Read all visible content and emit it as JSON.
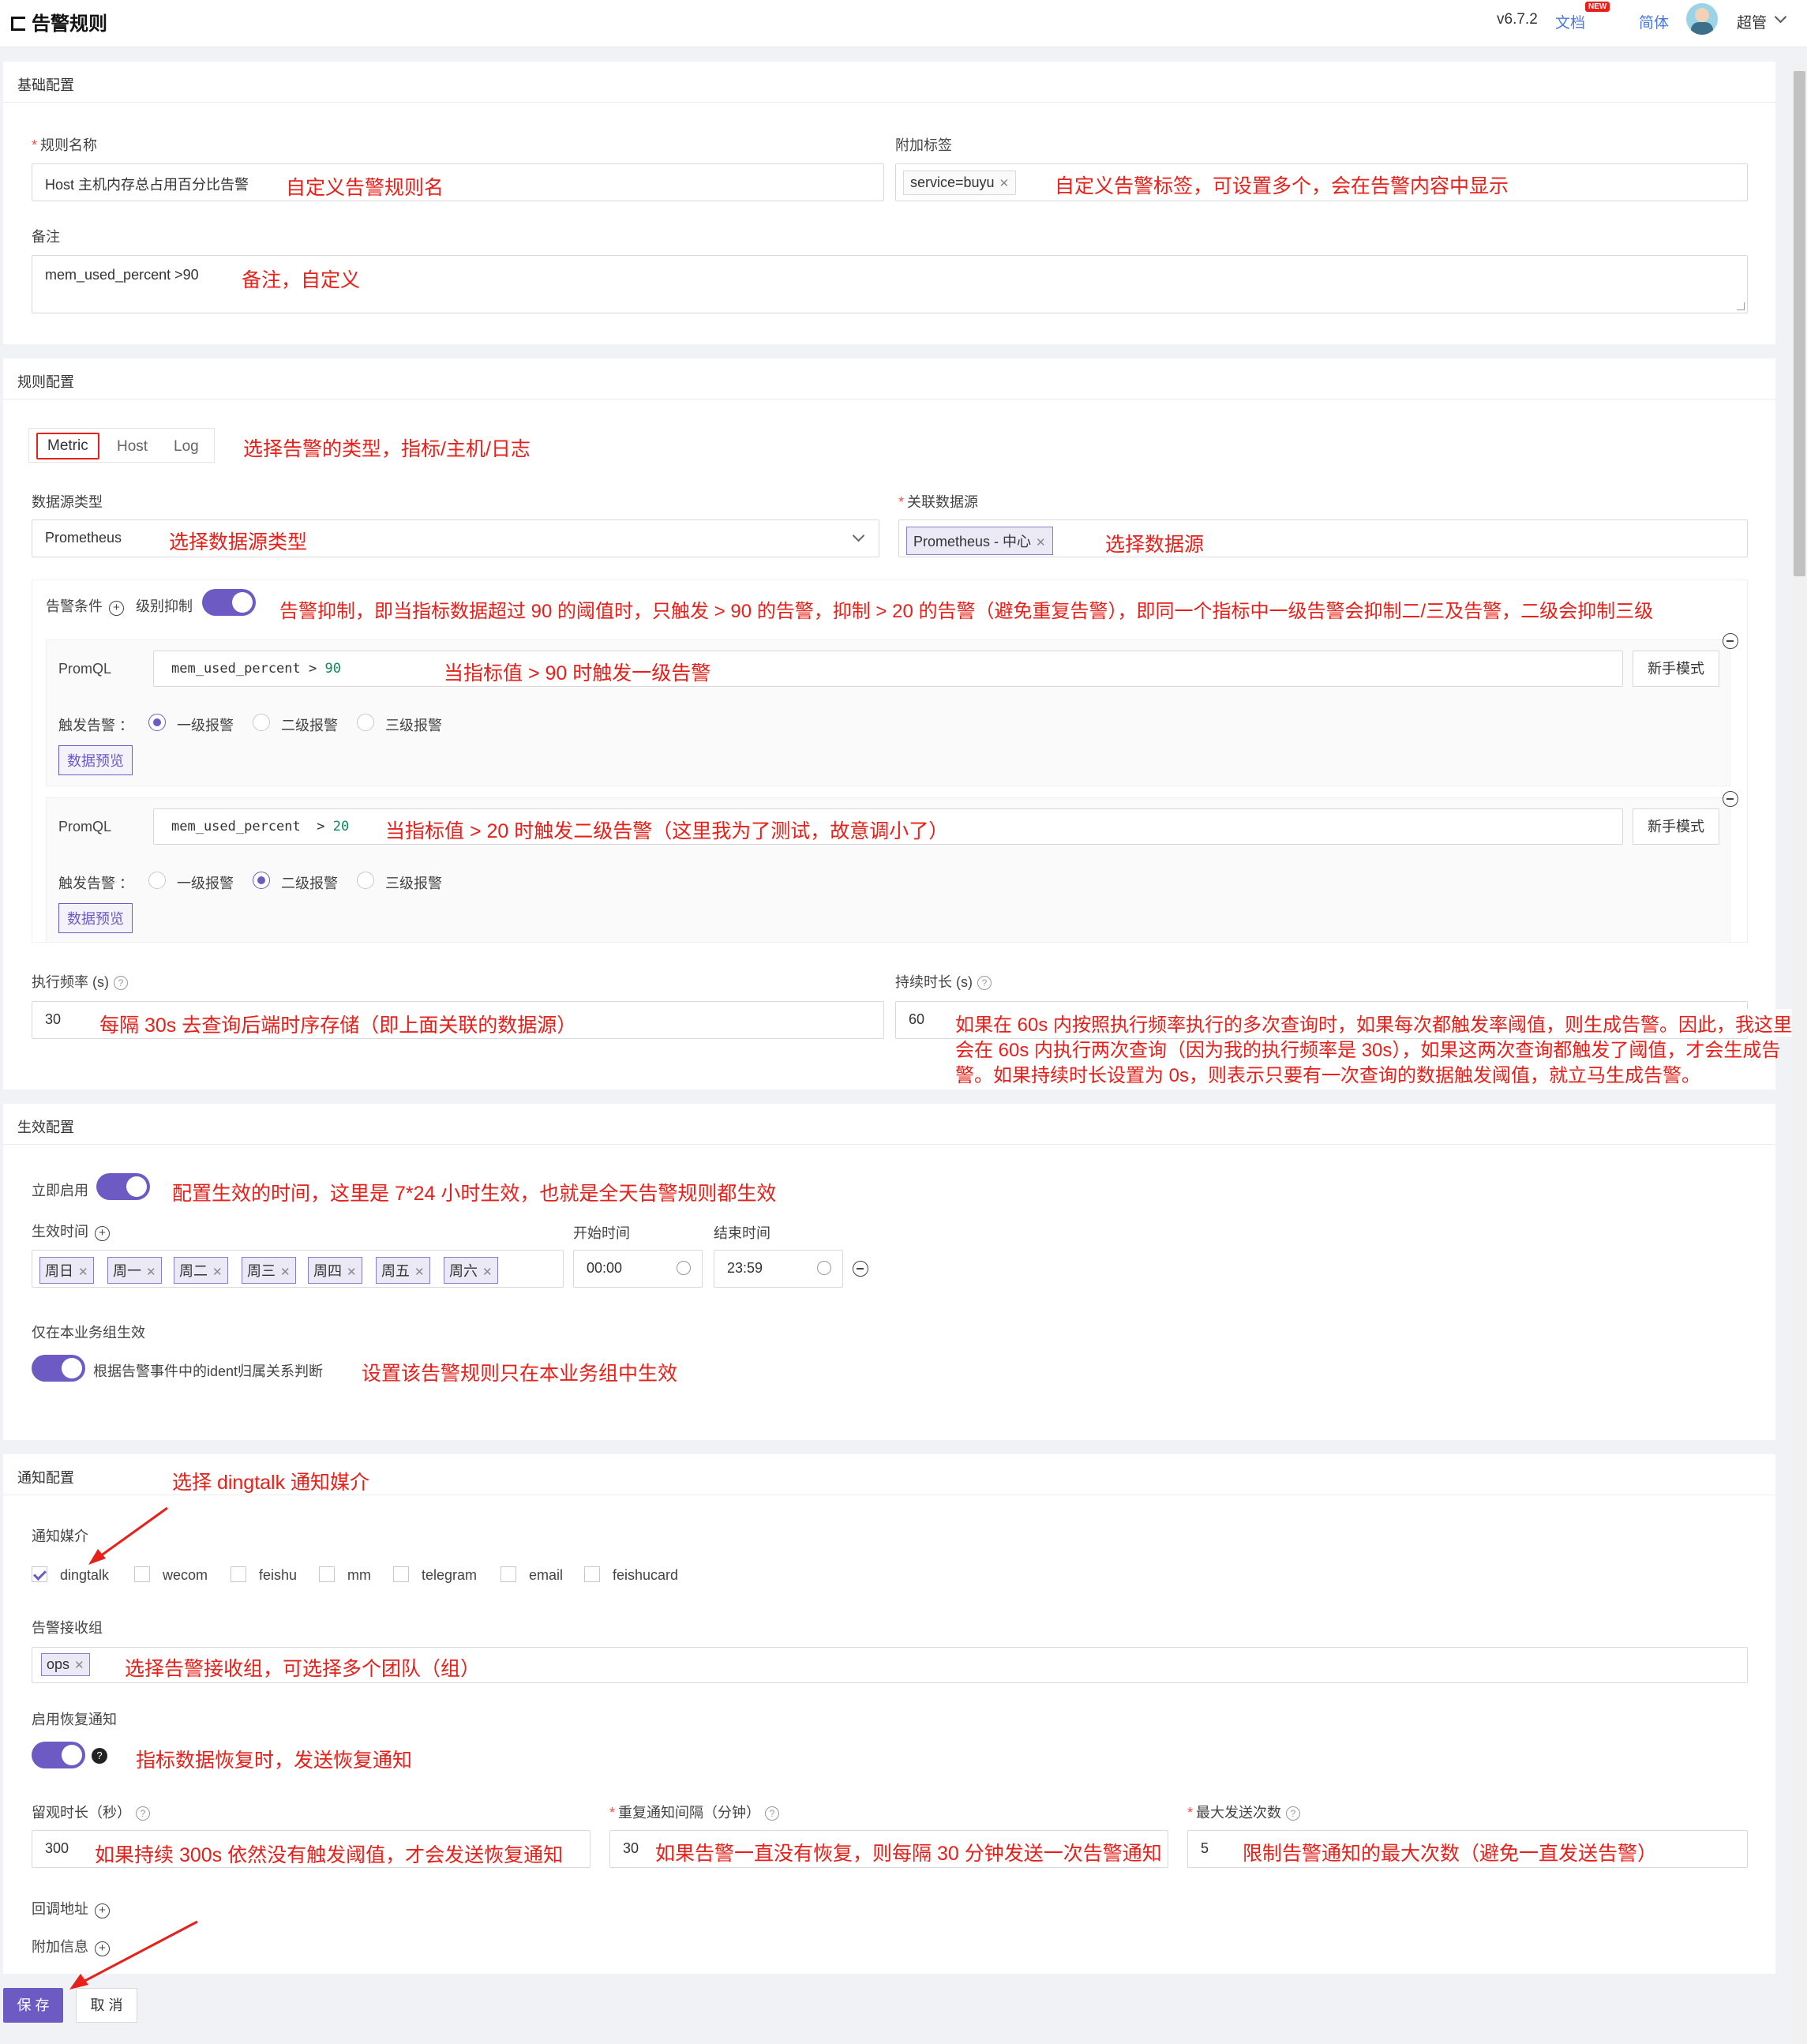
{
  "header": {
    "title": "告警规则",
    "version": "v6.7.2",
    "docs_label": "文档",
    "new_badge": "NEW",
    "lang_label": "简体",
    "user_name": "超管"
  },
  "basic": {
    "section_title": "基础配置",
    "rule_name_label": "规则名称",
    "rule_name_value": "Host 主机内存总占用百分比告警",
    "rule_name_note": "自定义告警规则名",
    "tags_label": "附加标签",
    "tag_value": "service=buyu",
    "tags_note": "自定义告警标签，可设置多个，会在告警内容中显示",
    "remark_label": "备注",
    "remark_value": "mem_used_percent >90",
    "remark_note": "备注，自定义"
  },
  "rule": {
    "section_title": "规则配置",
    "tabs": [
      "Metric",
      "Host",
      "Log"
    ],
    "tabs_note": "选择告警的类型，指标/主机/日志",
    "ds_type_label": "数据源类型",
    "ds_type_value": "Prometheus",
    "ds_type_note": "选择数据源类型",
    "ds_label": "关联数据源",
    "ds_tag": "Prometheus - 中心",
    "ds_note": "选择数据源",
    "cond_label": "告警条件",
    "suppress_label": "级别抑制",
    "suppress_note": "告警抑制，即当指标数据超过 90 的阈值时，只触发 > 90 的告警，抑制 > 20 的告警（避免重复告警），即同一个指标中一级告警会抑制二/三及告警，二级会抑制三级",
    "queries": [
      {
        "promql_label": "PromQL",
        "metric": "mem_used_percent",
        "op": " > ",
        "threshold": "90",
        "note": "当指标值 > 90 时触发一级告警",
        "mode_button": "新手模式",
        "trigger_label": "触发告警",
        "colon": "：",
        "levels": [
          "一级报警",
          "二级报警",
          "三级报警"
        ],
        "preview_button": "数据预览"
      },
      {
        "promql_label": "PromQL",
        "metric": "mem_used_percent",
        "op": "  > ",
        "threshold": "20",
        "note": "当指标值 > 20 时触发二级告警（这里我为了测试，故意调小了）",
        "mode_button": "新手模式",
        "trigger_label": "触发告警",
        "colon": "：",
        "levels": [
          "一级报警",
          "二级报警",
          "三级报警"
        ],
        "preview_button": "数据预览"
      }
    ],
    "freq_label": "执行频率 (s)",
    "freq_value": "30",
    "freq_note": "每隔 30s 去查询后端时序存储（即上面关联的数据源）",
    "duration_label": "持续时长 (s)",
    "duration_value": "60",
    "duration_note_1": "如果在 60s 内按照执行频率执行的多次查询时，如果每次都触发率阈值，则生成告警。因此，我这里",
    "duration_note_2": "会在 60s 内执行两次查询（因为我的执行频率是 30s），如果这两次查询都触发了阈值，才会生成告",
    "duration_note_3": "警。如果持续时长设置为 0s，则表示只要有一次查询的数据触发阈值，就立马生成告警。"
  },
  "effective": {
    "section_title": "生效配置",
    "enable_label": "立即启用",
    "enable_note": "配置生效的时间，这里是 7*24 小时生效，也就是全天告警规则都生效",
    "time_label": "生效时间",
    "days": [
      "周日",
      "周一",
      "周二",
      "周三",
      "周四",
      "周五",
      "周六"
    ],
    "start_label": "开始时间",
    "start_value": "00:00",
    "end_label": "结束时间",
    "end_value": "23:59",
    "bg_only_label": "仅在本业务组生效",
    "bg_only_desc": "根据告警事件中的ident归属关系判断",
    "bg_only_note": "设置该告警规则只在本业务组中生效"
  },
  "notify": {
    "section_title": "通知配置",
    "section_note": "选择 dingtalk 通知媒介",
    "channels_label": "通知媒介",
    "channels": [
      "dingtalk",
      "wecom",
      "feishu",
      "mm",
      "telegram",
      "email",
      "feishucard"
    ],
    "receivers_label": "告警接收组",
    "receiver_tag": "ops",
    "receivers_note": "选择告警接收组，可选择多个团队（组）",
    "recover_label": "启用恢复通知",
    "recover_note": "指标数据恢复时，发送恢复通知",
    "observe_label": "留观时长（秒）",
    "observe_value": "300",
    "observe_note": "如果持续 300s 依然没有触发阈值，才会发送恢复通知",
    "repeat_label": "重复通知间隔（分钟）",
    "repeat_value": "30",
    "repeat_note": "如果告警一直没有恢复，则每隔 30 分钟发送一次告警通知",
    "max_label": "最大发送次数",
    "max_value": "5",
    "max_note": "限制告警通知的最大次数（避免一直发送告警）",
    "callback_label": "回调地址",
    "extra_label": "附加信息"
  },
  "footer": {
    "save_button": "保 存",
    "cancel_button": "取 消"
  },
  "colors": {
    "accent": "#6d5bc3",
    "annotation": "#e8201a"
  }
}
